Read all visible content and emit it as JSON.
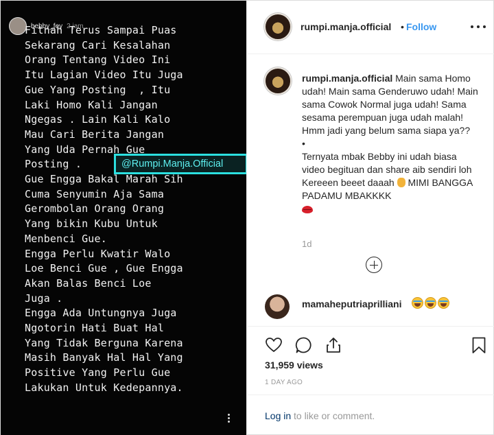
{
  "story": {
    "username": "bebby_fey",
    "time": "2 jam",
    "lines": [
      "Fitnah Terus Sampai Puas",
      "Sekarang Cari Kesalahan",
      "Orang Tentang Video Ini",
      "Itu Lagian Video Itu Juga",
      "Gue Yang Posting  , Itu",
      "Laki Homo Kali Jangan",
      "Ngegas . Lain Kali Kalo",
      "Mau Cari Berita Jangan",
      "Yang Uda Pernah Gue",
      "Posting .",
      "Gue Engga Bakal Marah Sih",
      "Cuma Senyumin Aja Sama",
      "Gerombolan Orang Orang",
      "Yang bikin Kubu Untuk",
      "Menbenci Gue.",
      "Engga Perlu Kwatir Walo",
      "Loe Benci Gue , Gue Engga",
      "Akan Balas Benci Loe",
      "Juga .",
      "Engga Ada Untungnya Juga",
      "Ngotorin Hati Buat Hal",
      "Yang Tidak Berguna Karena",
      "Masih Banyak Hal Hal Yang",
      "Positive Yang Perlu Gue",
      "Lakukan Untuk Kedepannya."
    ],
    "tag": "@Rumpi.Manja.Official",
    "tag_color": "#2be0e0"
  },
  "header": {
    "username": "rumpi.manja.official",
    "separator": "•",
    "follow_label": "Follow",
    "follow_color": "#3897f0"
  },
  "caption": {
    "username": "rumpi.manja.official",
    "paragraph1": "Main sama Homo udah! Main sama Genderuwo udah! Main sama Cowok Normal juga udah! Sama sesama perempuan juga udah malah! Hmm jadi yang belum sama siapa ya??",
    "bullet": "•",
    "paragraph2": "Ternyata mbak Bebby ini udah biasa video begituan dan share aib sendiri loh Kereeen beeet daaah",
    "paragraph3": "MIMI BANGGA PADAMU MBAKKKK",
    "time": "1d"
  },
  "comment": {
    "username": "mamaheputriaprilliani",
    "emoji": "face-with-tears-of-joy x3"
  },
  "actions": {
    "icons": [
      "heart-icon",
      "comment-icon",
      "share-icon",
      "bookmark-icon"
    ]
  },
  "stats": {
    "views": "31,959 views",
    "ago": "1 DAY AGO"
  },
  "login": {
    "link": "Log in",
    "rest": " to like or comment."
  }
}
